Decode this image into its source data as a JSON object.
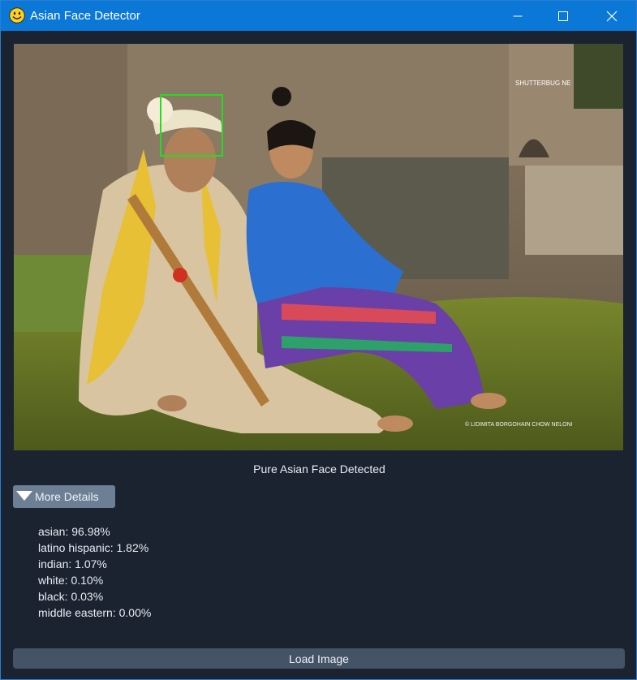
{
  "window": {
    "title": "Asian Face Detector",
    "app_icon": "smiley-face-icon",
    "controls": [
      "minimize-icon",
      "maximize-icon",
      "close-icon"
    ]
  },
  "image": {
    "watermark_top": "SHUTTERBUG NE",
    "watermark_bottom": "© LIDIMITA BORGOHAIN  CHOW NELONI",
    "detection_box_color": "#22dd22"
  },
  "result": {
    "label": "Pure Asian Face Detected"
  },
  "details_toggle": {
    "icon": "triangle-down-icon",
    "label": "More Details",
    "expanded": true
  },
  "details": [
    "asian: 96.98%",
    "latino hispanic: 1.82%",
    "indian: 1.07%",
    "white: 0.10%",
    "black: 0.03%",
    "middle eastern: 0.00%"
  ],
  "actions": {
    "load_label": "Load Image"
  },
  "colors": {
    "background": "#1b2330",
    "titlebar": "#0b78d7",
    "button": "#455366",
    "toggle": "#6d7f95"
  }
}
